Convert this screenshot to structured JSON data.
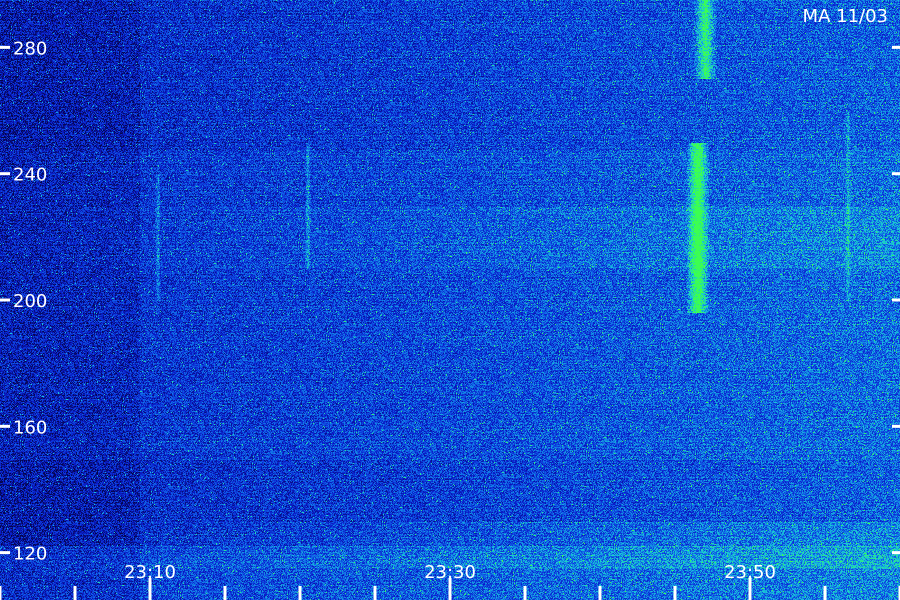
{
  "chart_data": {
    "type": "heatmap",
    "title": "MA 11/03",
    "xlabel": "",
    "ylabel": "",
    "x": {
      "tick_labels": [
        "23:10",
        "23:30",
        "23:50"
      ],
      "range_minutes_after_23h": [
        0.0,
        60.0
      ],
      "labeled_tick_minutes": [
        10,
        30,
        50
      ],
      "minor_tick_minutes": [
        -0.0,
        5,
        10,
        15,
        20,
        25,
        30,
        35,
        40,
        45,
        50,
        55,
        60
      ]
    },
    "y": {
      "tick_labels": [
        "280",
        "240",
        "200",
        "160",
        "120"
      ],
      "tick_values": [
        280,
        240,
        200,
        160,
        120
      ],
      "range": [
        105,
        295
      ]
    },
    "colormap": [
      "#05054a",
      "#0a1cc8",
      "#1060e8",
      "#18c8d8",
      "#3cff50"
    ],
    "features": [
      {
        "kind": "vertical-burst",
        "x_minutes": 46.5,
        "y_range": [
          196,
          250
        ],
        "intensity": 0.95
      },
      {
        "kind": "vertical-burst",
        "x_minutes": 47.0,
        "y_range": [
          270,
          295
        ],
        "intensity": 0.8
      },
      {
        "kind": "vertical-line",
        "x_minutes": 20.5,
        "y_range": [
          210,
          250
        ],
        "intensity": 0.55
      },
      {
        "kind": "vertical-line",
        "x_minutes": 10.5,
        "y_range": [
          200,
          240
        ],
        "intensity": 0.45
      },
      {
        "kind": "vertical-line",
        "x_minutes": 56.5,
        "y_range": [
          200,
          260
        ],
        "intensity": 0.4
      },
      {
        "kind": "horizontal-band",
        "y_range": [
          115,
          130
        ],
        "intensity": 0.45
      },
      {
        "kind": "horizontal-band",
        "y_range": [
          210,
          230
        ],
        "intensity": 0.35
      }
    ]
  }
}
